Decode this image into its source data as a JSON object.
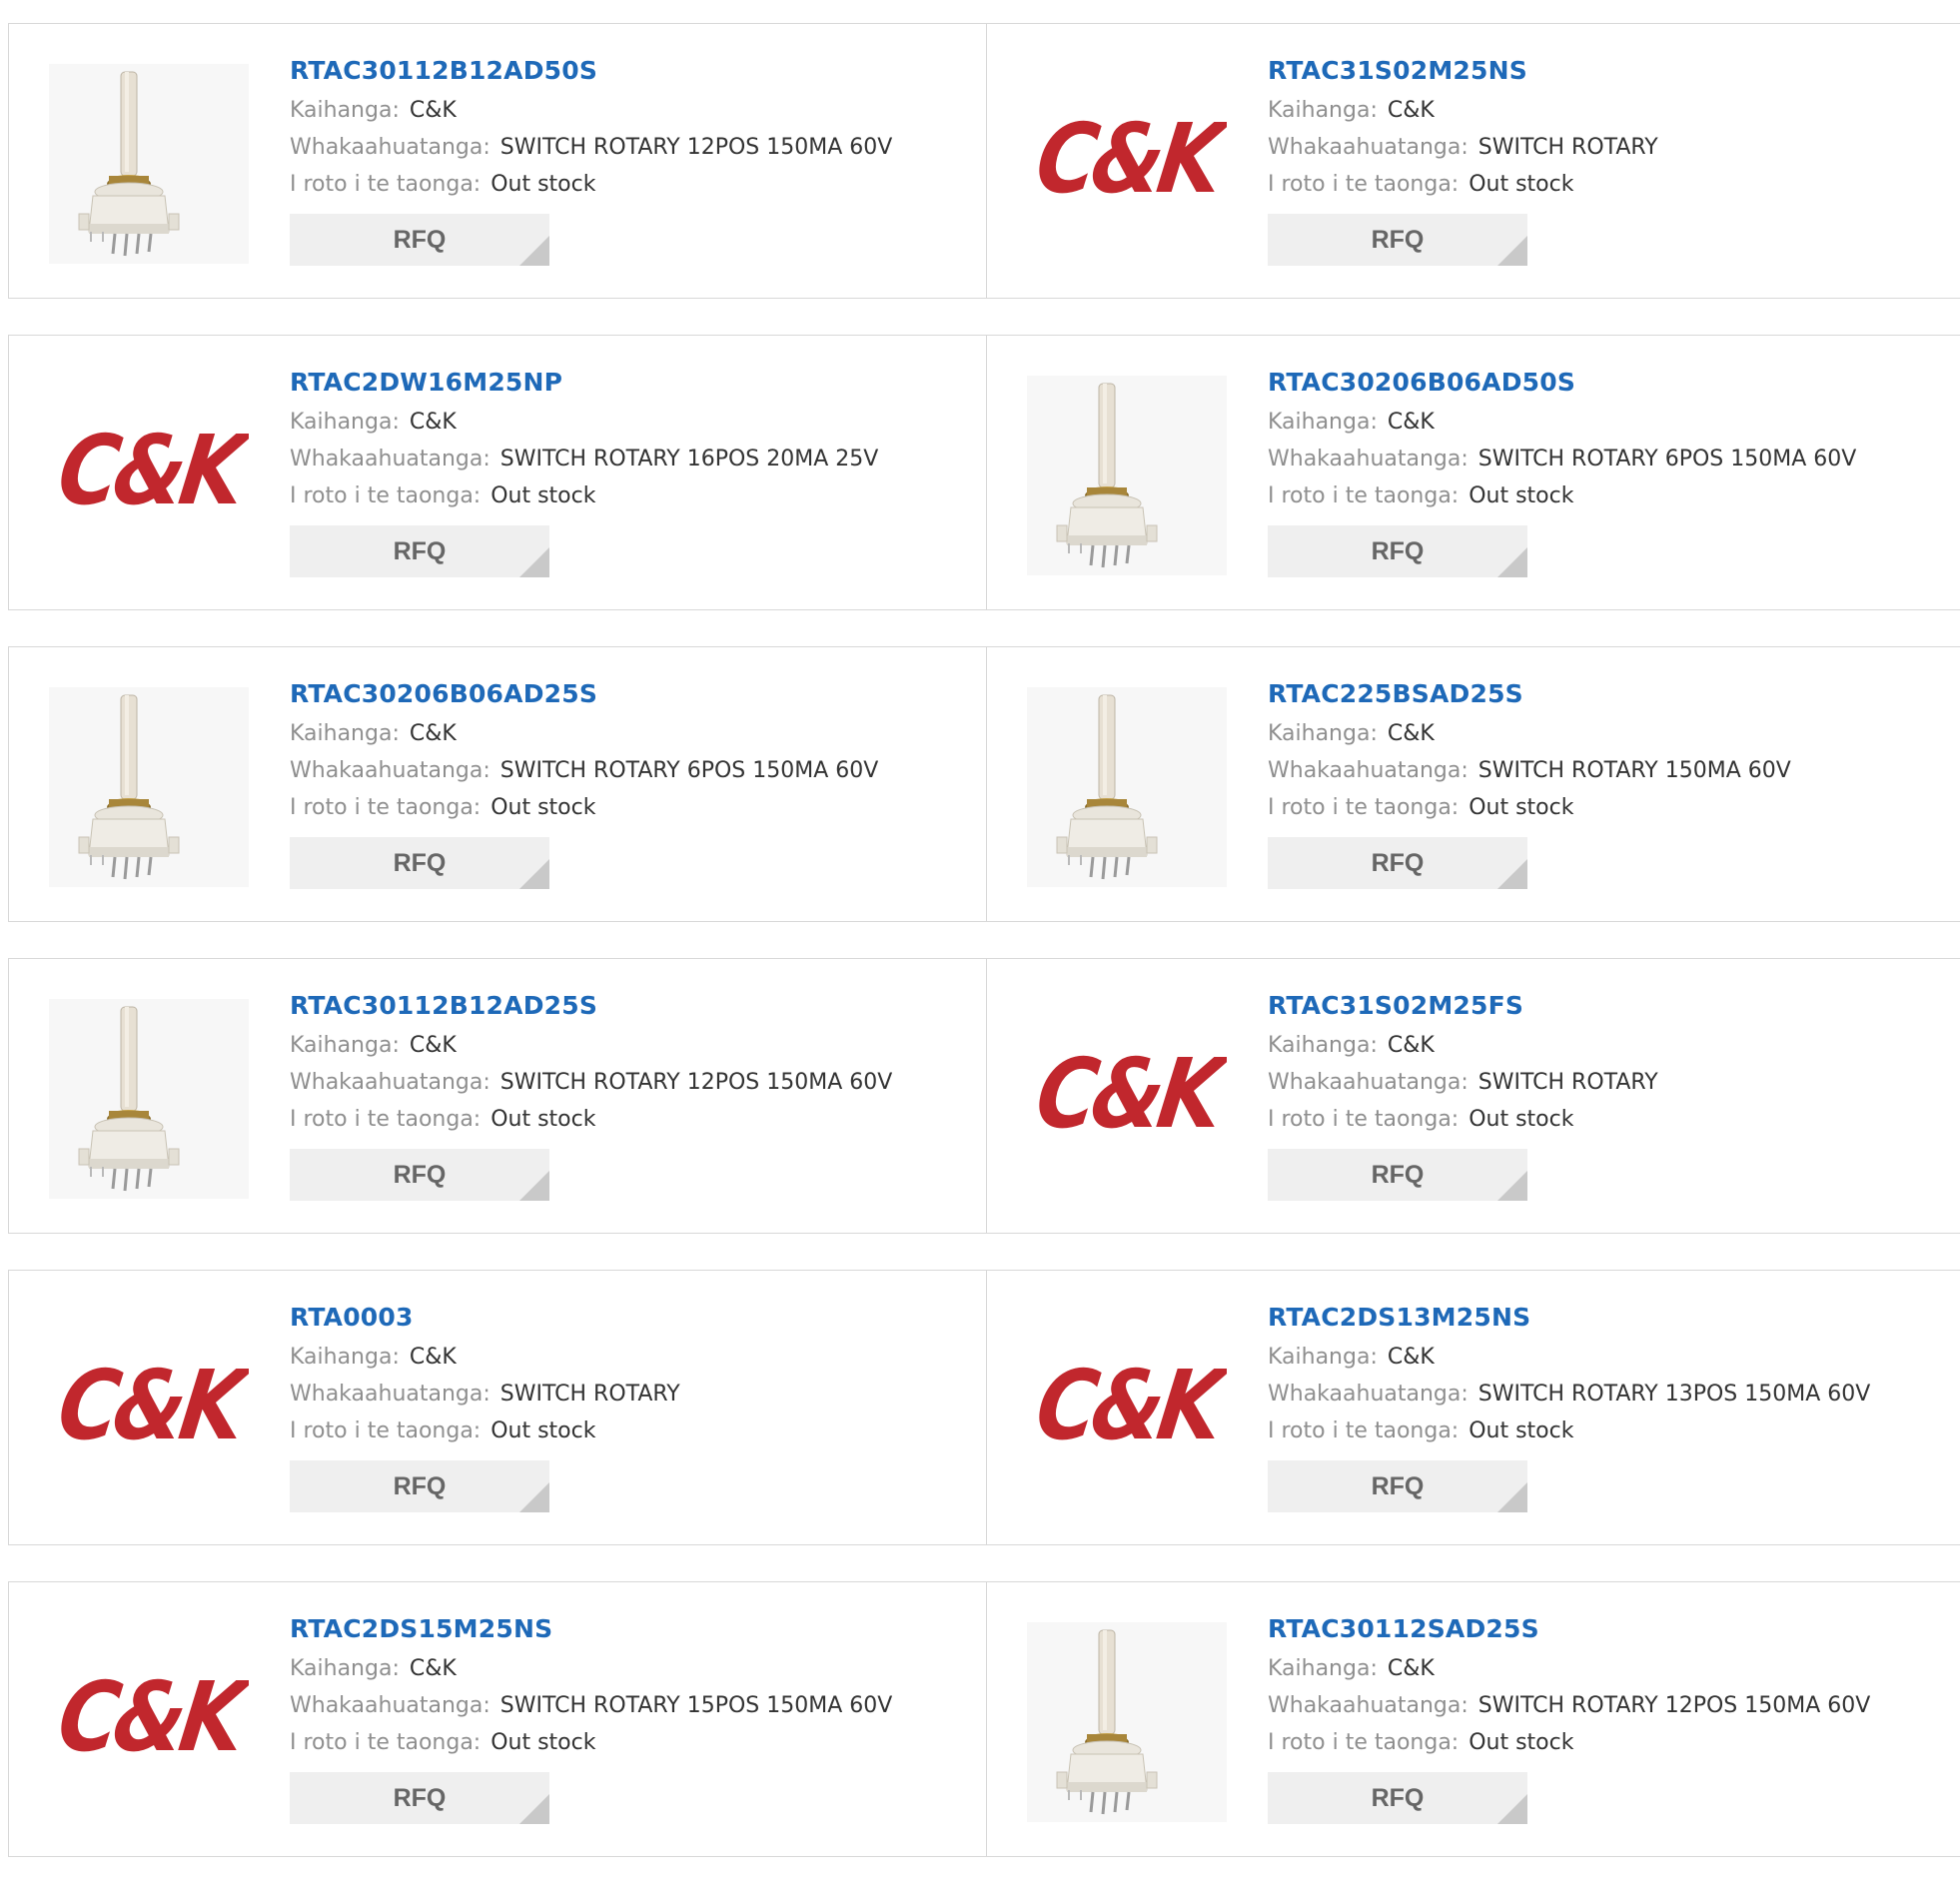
{
  "labels": {
    "manufacturer": "Kaihanga:",
    "description": "Whakaahuatanga:",
    "stock": "I roto i te taonga:",
    "rfq": "RFQ"
  },
  "colors": {
    "part_link": "#1e69b8",
    "brand_red": "#c1272d",
    "label_gray": "#8f8f8f",
    "value_dark": "#333333",
    "rfq_bg": "#efefef"
  },
  "rows": [
    [
      {
        "part": "RTAC30112B12AD50S",
        "manufacturer": "C&K",
        "description": "SWITCH ROTARY 12POS 150MA 60V",
        "stock": "Out stock",
        "image": "rotary-switch-photo"
      },
      {
        "part": "RTAC31S02M25NS",
        "manufacturer": "C&K",
        "description": "SWITCH ROTARY",
        "stock": "Out stock",
        "image": "ck-logo"
      }
    ],
    [
      {
        "part": "RTAC2DW16M25NP",
        "manufacturer": "C&K",
        "description": "SWITCH ROTARY 16POS 20MA 25V",
        "stock": "Out stock",
        "image": "ck-logo"
      },
      {
        "part": "RTAC30206B06AD50S",
        "manufacturer": "C&K",
        "description": "SWITCH ROTARY 6POS 150MA 60V",
        "stock": "Out stock",
        "image": "rotary-switch-photo"
      }
    ],
    [
      {
        "part": "RTAC30206B06AD25S",
        "manufacturer": "C&K",
        "description": "SWITCH ROTARY 6POS 150MA 60V",
        "stock": "Out stock",
        "image": "rotary-switch-photo"
      },
      {
        "part": "RTAC225BSAD25S",
        "manufacturer": "C&K",
        "description": "SWITCH ROTARY 150MA 60V",
        "stock": "Out stock",
        "image": "rotary-switch-photo"
      }
    ],
    [
      {
        "part": "RTAC30112B12AD25S",
        "manufacturer": "C&K",
        "description": "SWITCH ROTARY 12POS 150MA 60V",
        "stock": "Out stock",
        "image": "rotary-switch-photo"
      },
      {
        "part": "RTAC31S02M25FS",
        "manufacturer": "C&K",
        "description": "SWITCH ROTARY",
        "stock": "Out stock",
        "image": "ck-logo"
      }
    ],
    [
      {
        "part": "RTA0003",
        "manufacturer": "C&K",
        "description": "SWITCH ROTARY",
        "stock": "Out stock",
        "image": "ck-logo"
      },
      {
        "part": "RTAC2DS13M25NS",
        "manufacturer": "C&K",
        "description": "SWITCH ROTARY 13POS 150MA 60V",
        "stock": "Out stock",
        "image": "ck-logo"
      }
    ],
    [
      {
        "part": "RTAC2DS15M25NS",
        "manufacturer": "C&K",
        "description": "SWITCH ROTARY 15POS 150MA 60V",
        "stock": "Out stock",
        "image": "ck-logo"
      },
      {
        "part": "RTAC30112SAD25S",
        "manufacturer": "C&K",
        "description": "SWITCH ROTARY 12POS 150MA 60V",
        "stock": "Out stock",
        "image": "rotary-switch-photo"
      }
    ]
  ]
}
